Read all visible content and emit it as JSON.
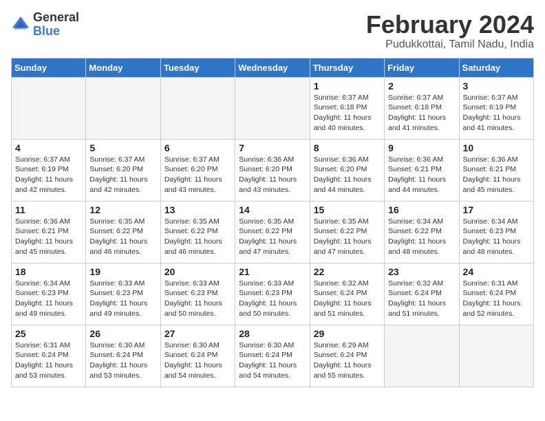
{
  "header": {
    "logo_general": "General",
    "logo_blue": "Blue",
    "title": "February 2024",
    "subtitle": "Pudukkottai, Tamil Nadu, India"
  },
  "days_of_week": [
    "Sunday",
    "Monday",
    "Tuesday",
    "Wednesday",
    "Thursday",
    "Friday",
    "Saturday"
  ],
  "weeks": [
    [
      {
        "day": "",
        "info": ""
      },
      {
        "day": "",
        "info": ""
      },
      {
        "day": "",
        "info": ""
      },
      {
        "day": "",
        "info": ""
      },
      {
        "day": "1",
        "info": "Sunrise: 6:37 AM\nSunset: 6:18 PM\nDaylight: 11 hours and 40 minutes."
      },
      {
        "day": "2",
        "info": "Sunrise: 6:37 AM\nSunset: 6:18 PM\nDaylight: 11 hours and 41 minutes."
      },
      {
        "day": "3",
        "info": "Sunrise: 6:37 AM\nSunset: 6:19 PM\nDaylight: 11 hours and 41 minutes."
      }
    ],
    [
      {
        "day": "4",
        "info": "Sunrise: 6:37 AM\nSunset: 6:19 PM\nDaylight: 11 hours and 42 minutes."
      },
      {
        "day": "5",
        "info": "Sunrise: 6:37 AM\nSunset: 6:20 PM\nDaylight: 11 hours and 42 minutes."
      },
      {
        "day": "6",
        "info": "Sunrise: 6:37 AM\nSunset: 6:20 PM\nDaylight: 11 hours and 43 minutes."
      },
      {
        "day": "7",
        "info": "Sunrise: 6:36 AM\nSunset: 6:20 PM\nDaylight: 11 hours and 43 minutes."
      },
      {
        "day": "8",
        "info": "Sunrise: 6:36 AM\nSunset: 6:20 PM\nDaylight: 11 hours and 44 minutes."
      },
      {
        "day": "9",
        "info": "Sunrise: 6:36 AM\nSunset: 6:21 PM\nDaylight: 11 hours and 44 minutes."
      },
      {
        "day": "10",
        "info": "Sunrise: 6:36 AM\nSunset: 6:21 PM\nDaylight: 11 hours and 45 minutes."
      }
    ],
    [
      {
        "day": "11",
        "info": "Sunrise: 6:36 AM\nSunset: 6:21 PM\nDaylight: 11 hours and 45 minutes."
      },
      {
        "day": "12",
        "info": "Sunrise: 6:35 AM\nSunset: 6:22 PM\nDaylight: 11 hours and 46 minutes."
      },
      {
        "day": "13",
        "info": "Sunrise: 6:35 AM\nSunset: 6:22 PM\nDaylight: 11 hours and 46 minutes."
      },
      {
        "day": "14",
        "info": "Sunrise: 6:35 AM\nSunset: 6:22 PM\nDaylight: 11 hours and 47 minutes."
      },
      {
        "day": "15",
        "info": "Sunrise: 6:35 AM\nSunset: 6:22 PM\nDaylight: 11 hours and 47 minutes."
      },
      {
        "day": "16",
        "info": "Sunrise: 6:34 AM\nSunset: 6:22 PM\nDaylight: 11 hours and 48 minutes."
      },
      {
        "day": "17",
        "info": "Sunrise: 6:34 AM\nSunset: 6:23 PM\nDaylight: 11 hours and 48 minutes."
      }
    ],
    [
      {
        "day": "18",
        "info": "Sunrise: 6:34 AM\nSunset: 6:23 PM\nDaylight: 11 hours and 49 minutes."
      },
      {
        "day": "19",
        "info": "Sunrise: 6:33 AM\nSunset: 6:23 PM\nDaylight: 11 hours and 49 minutes."
      },
      {
        "day": "20",
        "info": "Sunrise: 6:33 AM\nSunset: 6:23 PM\nDaylight: 11 hours and 50 minutes."
      },
      {
        "day": "21",
        "info": "Sunrise: 6:33 AM\nSunset: 6:23 PM\nDaylight: 11 hours and 50 minutes."
      },
      {
        "day": "22",
        "info": "Sunrise: 6:32 AM\nSunset: 6:24 PM\nDaylight: 11 hours and 51 minutes."
      },
      {
        "day": "23",
        "info": "Sunrise: 6:32 AM\nSunset: 6:24 PM\nDaylight: 11 hours and 51 minutes."
      },
      {
        "day": "24",
        "info": "Sunrise: 6:31 AM\nSunset: 6:24 PM\nDaylight: 11 hours and 52 minutes."
      }
    ],
    [
      {
        "day": "25",
        "info": "Sunrise: 6:31 AM\nSunset: 6:24 PM\nDaylight: 11 hours and 53 minutes."
      },
      {
        "day": "26",
        "info": "Sunrise: 6:30 AM\nSunset: 6:24 PM\nDaylight: 11 hours and 53 minutes."
      },
      {
        "day": "27",
        "info": "Sunrise: 6:30 AM\nSunset: 6:24 PM\nDaylight: 11 hours and 54 minutes."
      },
      {
        "day": "28",
        "info": "Sunrise: 6:30 AM\nSunset: 6:24 PM\nDaylight: 11 hours and 54 minutes."
      },
      {
        "day": "29",
        "info": "Sunrise: 6:29 AM\nSunset: 6:24 PM\nDaylight: 11 hours and 55 minutes."
      },
      {
        "day": "",
        "info": ""
      },
      {
        "day": "",
        "info": ""
      }
    ]
  ]
}
